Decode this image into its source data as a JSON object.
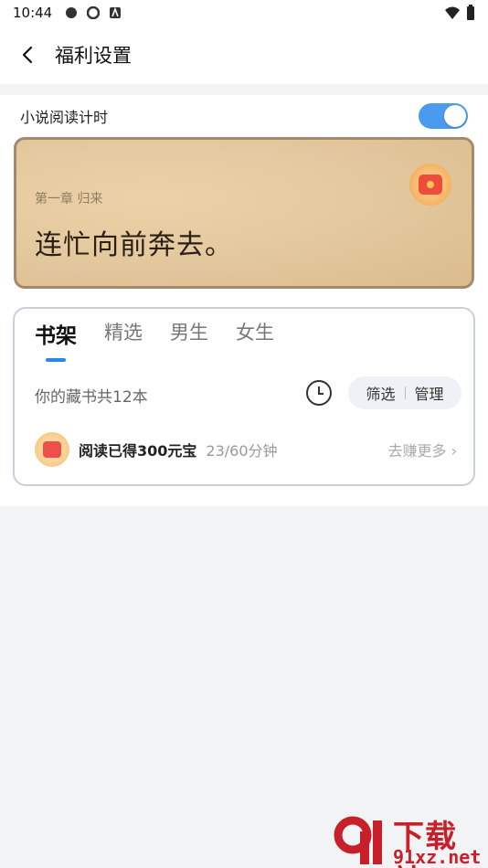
{
  "status_bar": {
    "time": "10:44"
  },
  "header": {
    "title": "福利设置"
  },
  "setting": {
    "label": "小说阅读计时",
    "enabled": true
  },
  "preview": {
    "chapter": "第一章 归来",
    "text": "连忙向前奔去。"
  },
  "shelf": {
    "tabs": [
      "书架",
      "精选",
      "男生",
      "女生"
    ],
    "active_tab": 0,
    "count_label": "你的藏书共12本",
    "filter_label": "筛选",
    "manage_label": "管理",
    "reward_title": "阅读已得300元宝",
    "reward_progress": "23/60分钟",
    "reward_more": "去赚更多 ›"
  },
  "watermark": {
    "line1": "下载站",
    "line2": "91xz.net"
  },
  "colors": {
    "accent": "#4a9bf0",
    "tab_indicator": "#2a86ef",
    "watermark": "#c7202a"
  }
}
